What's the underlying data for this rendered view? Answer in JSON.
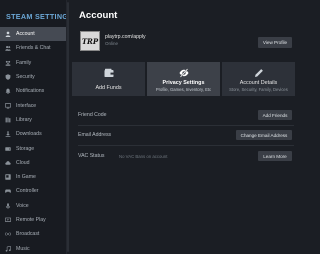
{
  "sidebar": {
    "title": "STEAM SETTINGS",
    "items": [
      {
        "label": "Account",
        "icon": "user-icon",
        "active": true
      },
      {
        "label": "Friends & Chat",
        "icon": "friends-icon"
      },
      {
        "label": "Family",
        "icon": "family-icon"
      },
      {
        "label": "Security",
        "icon": "shield-icon"
      },
      {
        "label": "Notifications",
        "icon": "bell-icon"
      },
      {
        "label": "Interface",
        "icon": "monitor-icon"
      },
      {
        "label": "Library",
        "icon": "library-icon"
      },
      {
        "label": "Downloads",
        "icon": "download-icon"
      },
      {
        "label": "Storage",
        "icon": "storage-icon"
      },
      {
        "label": "Cloud",
        "icon": "cloud-icon"
      },
      {
        "label": "In Game",
        "icon": "in-game-icon"
      },
      {
        "label": "Controller",
        "icon": "controller-icon"
      },
      {
        "label": "Voice",
        "icon": "microphone-icon"
      },
      {
        "label": "Remote Play",
        "icon": "remote-play-icon"
      },
      {
        "label": "Broadcast",
        "icon": "broadcast-icon"
      },
      {
        "label": "Music",
        "icon": "music-icon"
      }
    ]
  },
  "main": {
    "title": "Account",
    "profile": {
      "avatar_text": "TRP",
      "name": "playtrp.com/apply",
      "status": "Online",
      "view_profile_label": "View Profile"
    },
    "cards": [
      {
        "title": "Add Funds",
        "subtitle": "",
        "icon": "wallet-icon"
      },
      {
        "title": "Privacy Settings",
        "subtitle": "Profile, Games, Inventory, Etc",
        "icon": "eye-slash-icon",
        "highlighted": true
      },
      {
        "title": "Account Details",
        "subtitle": "Store, Security, Family, Devices",
        "icon": "pencil-icon"
      }
    ],
    "rows": [
      {
        "label": "Friend Code",
        "value": "",
        "button": "Add Friends"
      },
      {
        "label": "Email Address",
        "value": "",
        "button": "Change Email Address"
      },
      {
        "label": "VAC Status",
        "value": "No VAC Bans on account",
        "button": "Learn More"
      }
    ]
  },
  "colors": {
    "background": "#1b1e24",
    "sidebar": "#181b21",
    "accent_title": "#6ba7d6",
    "active_item": "#454a53",
    "card": "#2d3139",
    "card_highlight": "#3d4149",
    "button": "#3a3e46"
  }
}
